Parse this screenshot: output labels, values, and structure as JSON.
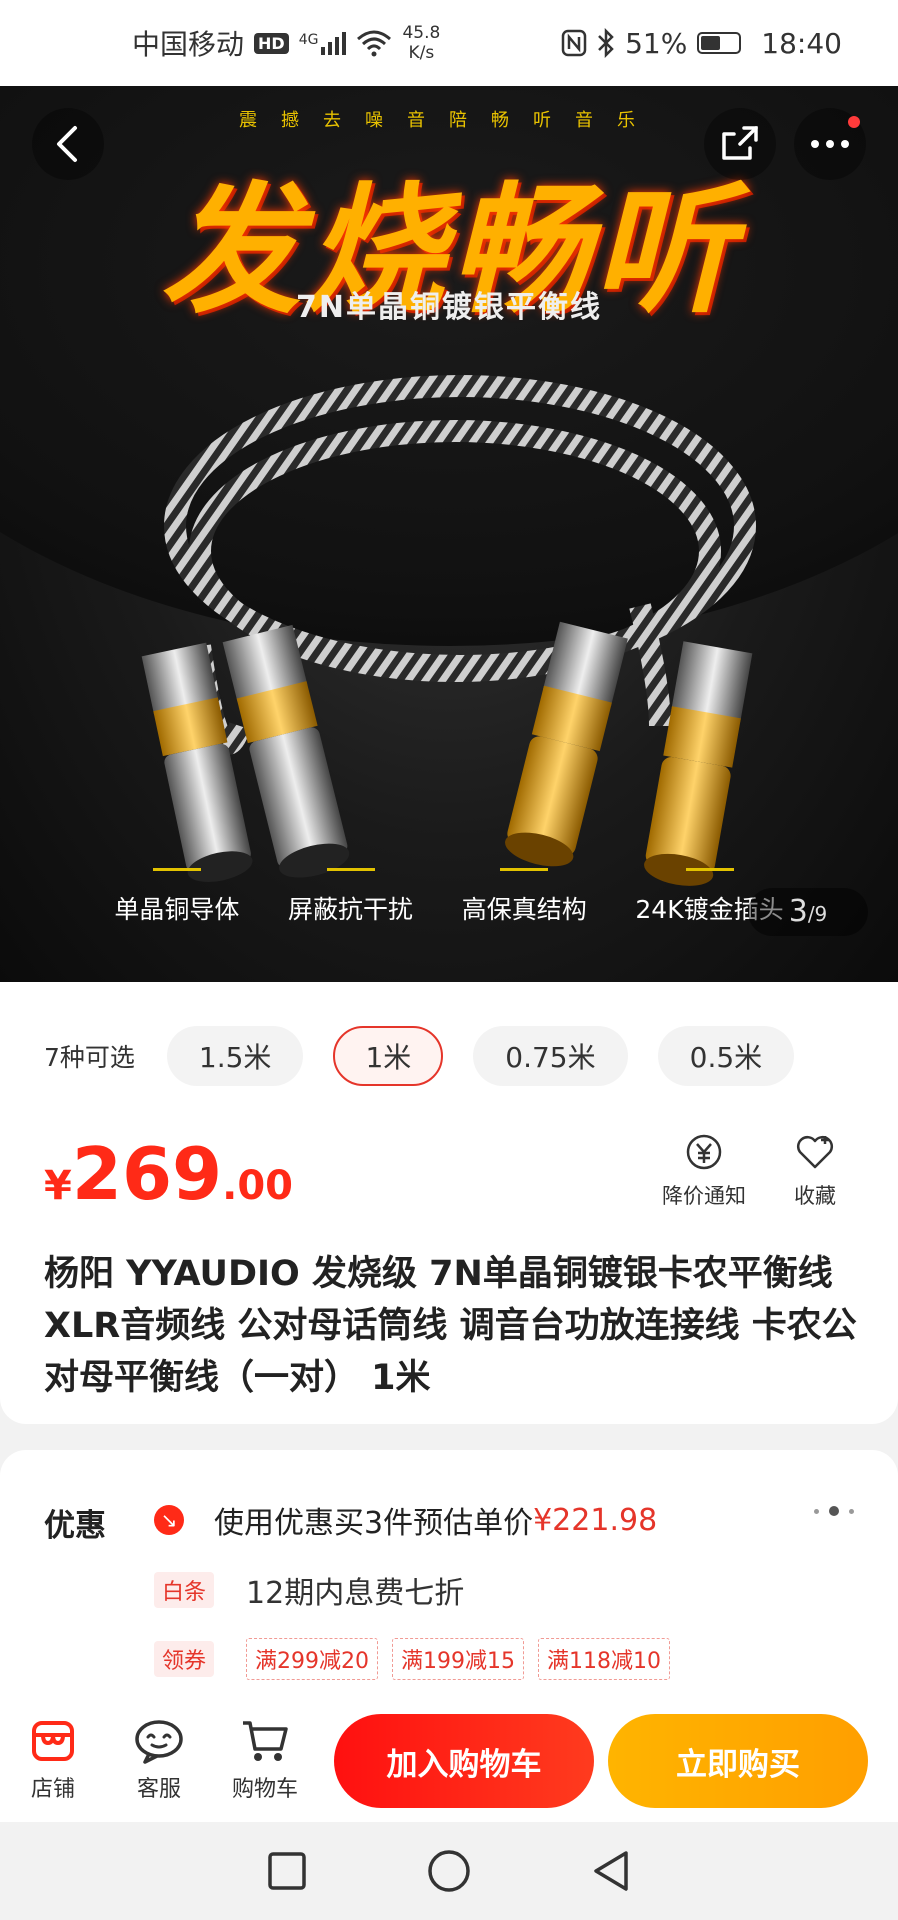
{
  "status_bar": {
    "carrier": "中国移动",
    "hd": "HD",
    "net_type": "4G",
    "speed_value": "45.8",
    "speed_unit": "K/s",
    "battery": "51%",
    "battery_level": 0.51,
    "time": "18:40"
  },
  "hero": {
    "top_text": "震撼去噪音陪畅听音乐",
    "title": "发烧畅听",
    "subtitle": "7N单晶铜镀银平衡线",
    "features": [
      "单晶铜导体",
      "屏蔽抗干扰",
      "高保真结构",
      "24K镀金插头"
    ],
    "counter_current": "3",
    "counter_total": "/9"
  },
  "variants": {
    "label": "7种可选",
    "options": [
      "1.5米",
      "1米",
      "0.75米",
      "0.5米"
    ],
    "selected": "1米"
  },
  "price": {
    "currency": "¥",
    "integer": "269",
    "decimal": ".00"
  },
  "price_actions": {
    "notify_label": "降价通知",
    "fav_label": "收藏"
  },
  "product": {
    "title": "杨阳 YYAUDIO 发烧级 7N单晶铜镀银卡农平衡线 XLR音频线 公对母话筒线 调音台功放连接线 卡农公对母平衡线（一对） 1米"
  },
  "promo": {
    "label": "优惠",
    "row1_text": "使用优惠买3件预估单价",
    "row1_price": "¥221.98",
    "baitiao_tag": "白条",
    "baitiao_text": "12期内息费七折",
    "coupon_tag": "领券",
    "coupons": [
      "满299减20",
      "满199减15",
      "满118减10"
    ]
  },
  "bottom_bar": {
    "store": "店铺",
    "service": "客服",
    "cart": "购物车",
    "add_to_cart": "加入购物车",
    "buy_now": "立即购买"
  },
  "colors": {
    "accent_red": "#e5352a",
    "price_red": "#ff2a17",
    "buy_orange": "#ffaa00"
  },
  "icons": [
    "back-icon",
    "share-icon",
    "more-icon",
    "price-notify-icon",
    "heart-icon",
    "store-icon",
    "service-icon",
    "cart-icon",
    "nav-square-icon",
    "nav-circle-icon",
    "nav-back-icon"
  ]
}
